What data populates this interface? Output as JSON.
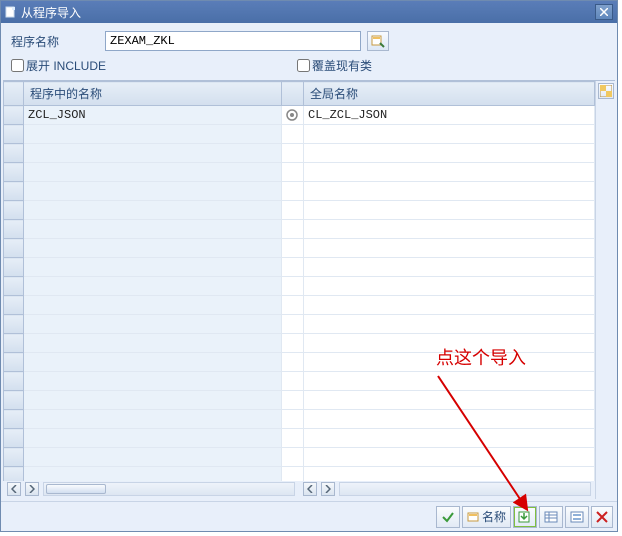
{
  "window": {
    "title": "从程序导入"
  },
  "form": {
    "program_label": "程序名称",
    "program_value": "ZEXAM_ZKL"
  },
  "checkboxes": {
    "expand_include_label": "展开 INCLUDE",
    "expand_include_checked": false,
    "overwrite_label": "覆盖现有类",
    "overwrite_checked": false
  },
  "table": {
    "col1_header": "程序中的名称",
    "col2_header": "全局名称",
    "rows": [
      {
        "name": "ZCL_JSON",
        "has_icon": true,
        "global": "CL_ZCL_JSON"
      }
    ],
    "empty_rows": 19
  },
  "toolbar": {
    "name_button_label": "名称"
  },
  "annotation": {
    "text": "点这个导入"
  }
}
